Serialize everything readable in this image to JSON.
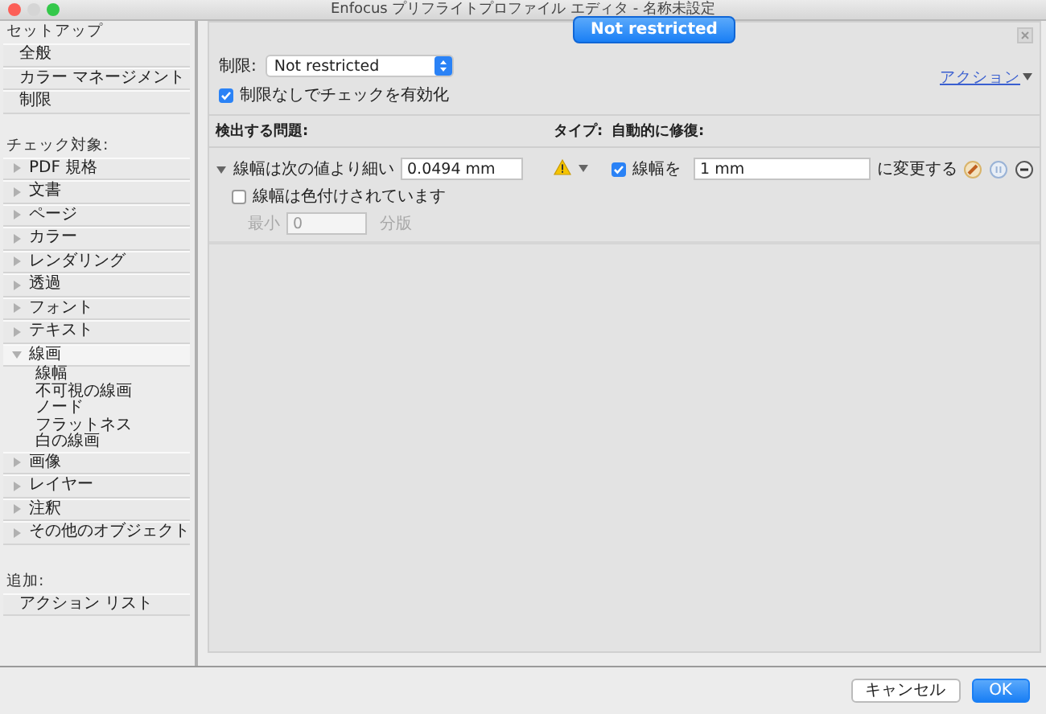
{
  "window": {
    "title": "Enfocus プリフライトプロファイル エディタ - 名称未設定"
  },
  "badge": "Not restricted",
  "sidebar": {
    "setup_heading": "セットアップ",
    "setup_items": [
      {
        "label": "全般"
      },
      {
        "label": "カラー マネージメント"
      },
      {
        "label": "制限"
      }
    ],
    "check_heading": "チェック対象:",
    "check_items": [
      {
        "label": "PDF 規格",
        "expanded": false
      },
      {
        "label": "文書",
        "expanded": false
      },
      {
        "label": "ページ",
        "expanded": false
      },
      {
        "label": "カラー",
        "expanded": false
      },
      {
        "label": "レンダリング",
        "expanded": false
      },
      {
        "label": "透過",
        "expanded": false
      },
      {
        "label": "フォント",
        "expanded": false
      },
      {
        "label": "テキスト",
        "expanded": false
      },
      {
        "label": "線画",
        "expanded": true,
        "children": [
          {
            "label": "線幅"
          },
          {
            "label": "不可視の線画"
          },
          {
            "label": "ノード"
          },
          {
            "label": "フラットネス"
          },
          {
            "label": "白の線画"
          }
        ]
      },
      {
        "label": "画像",
        "expanded": false
      },
      {
        "label": "レイヤー",
        "expanded": false
      },
      {
        "label": "注釈",
        "expanded": false
      },
      {
        "label": "その他のオブジェクト",
        "expanded": false
      }
    ],
    "add_heading": "追加:",
    "add_items": [
      {
        "label": "アクション リスト"
      }
    ]
  },
  "restriction": {
    "label": "制限:",
    "value": "Not restricted"
  },
  "enable_check": {
    "label": "制限なしでチェックを有効化",
    "checked": true
  },
  "action_link": "アクション",
  "columns": [
    "検出する問題:",
    "タイプ:",
    "自動的に修復:"
  ],
  "rule": {
    "expanded": true,
    "label": "線幅は次の値より細い",
    "value": "0.0494 mm",
    "colored": {
      "label": "線幅は色付けされています",
      "checked": false
    },
    "min": {
      "label": "最小",
      "placeholder": "0",
      "suffix": "分版",
      "disabled": true
    },
    "kind": "warning",
    "fix": {
      "checked": true,
      "label": "線幅を",
      "value": "1 mm",
      "suffix": "に変更する"
    }
  },
  "buttons": [
    {
      "label": "キャンセル",
      "kind": "secondary"
    },
    {
      "label": "OK",
      "kind": "primary"
    }
  ]
}
